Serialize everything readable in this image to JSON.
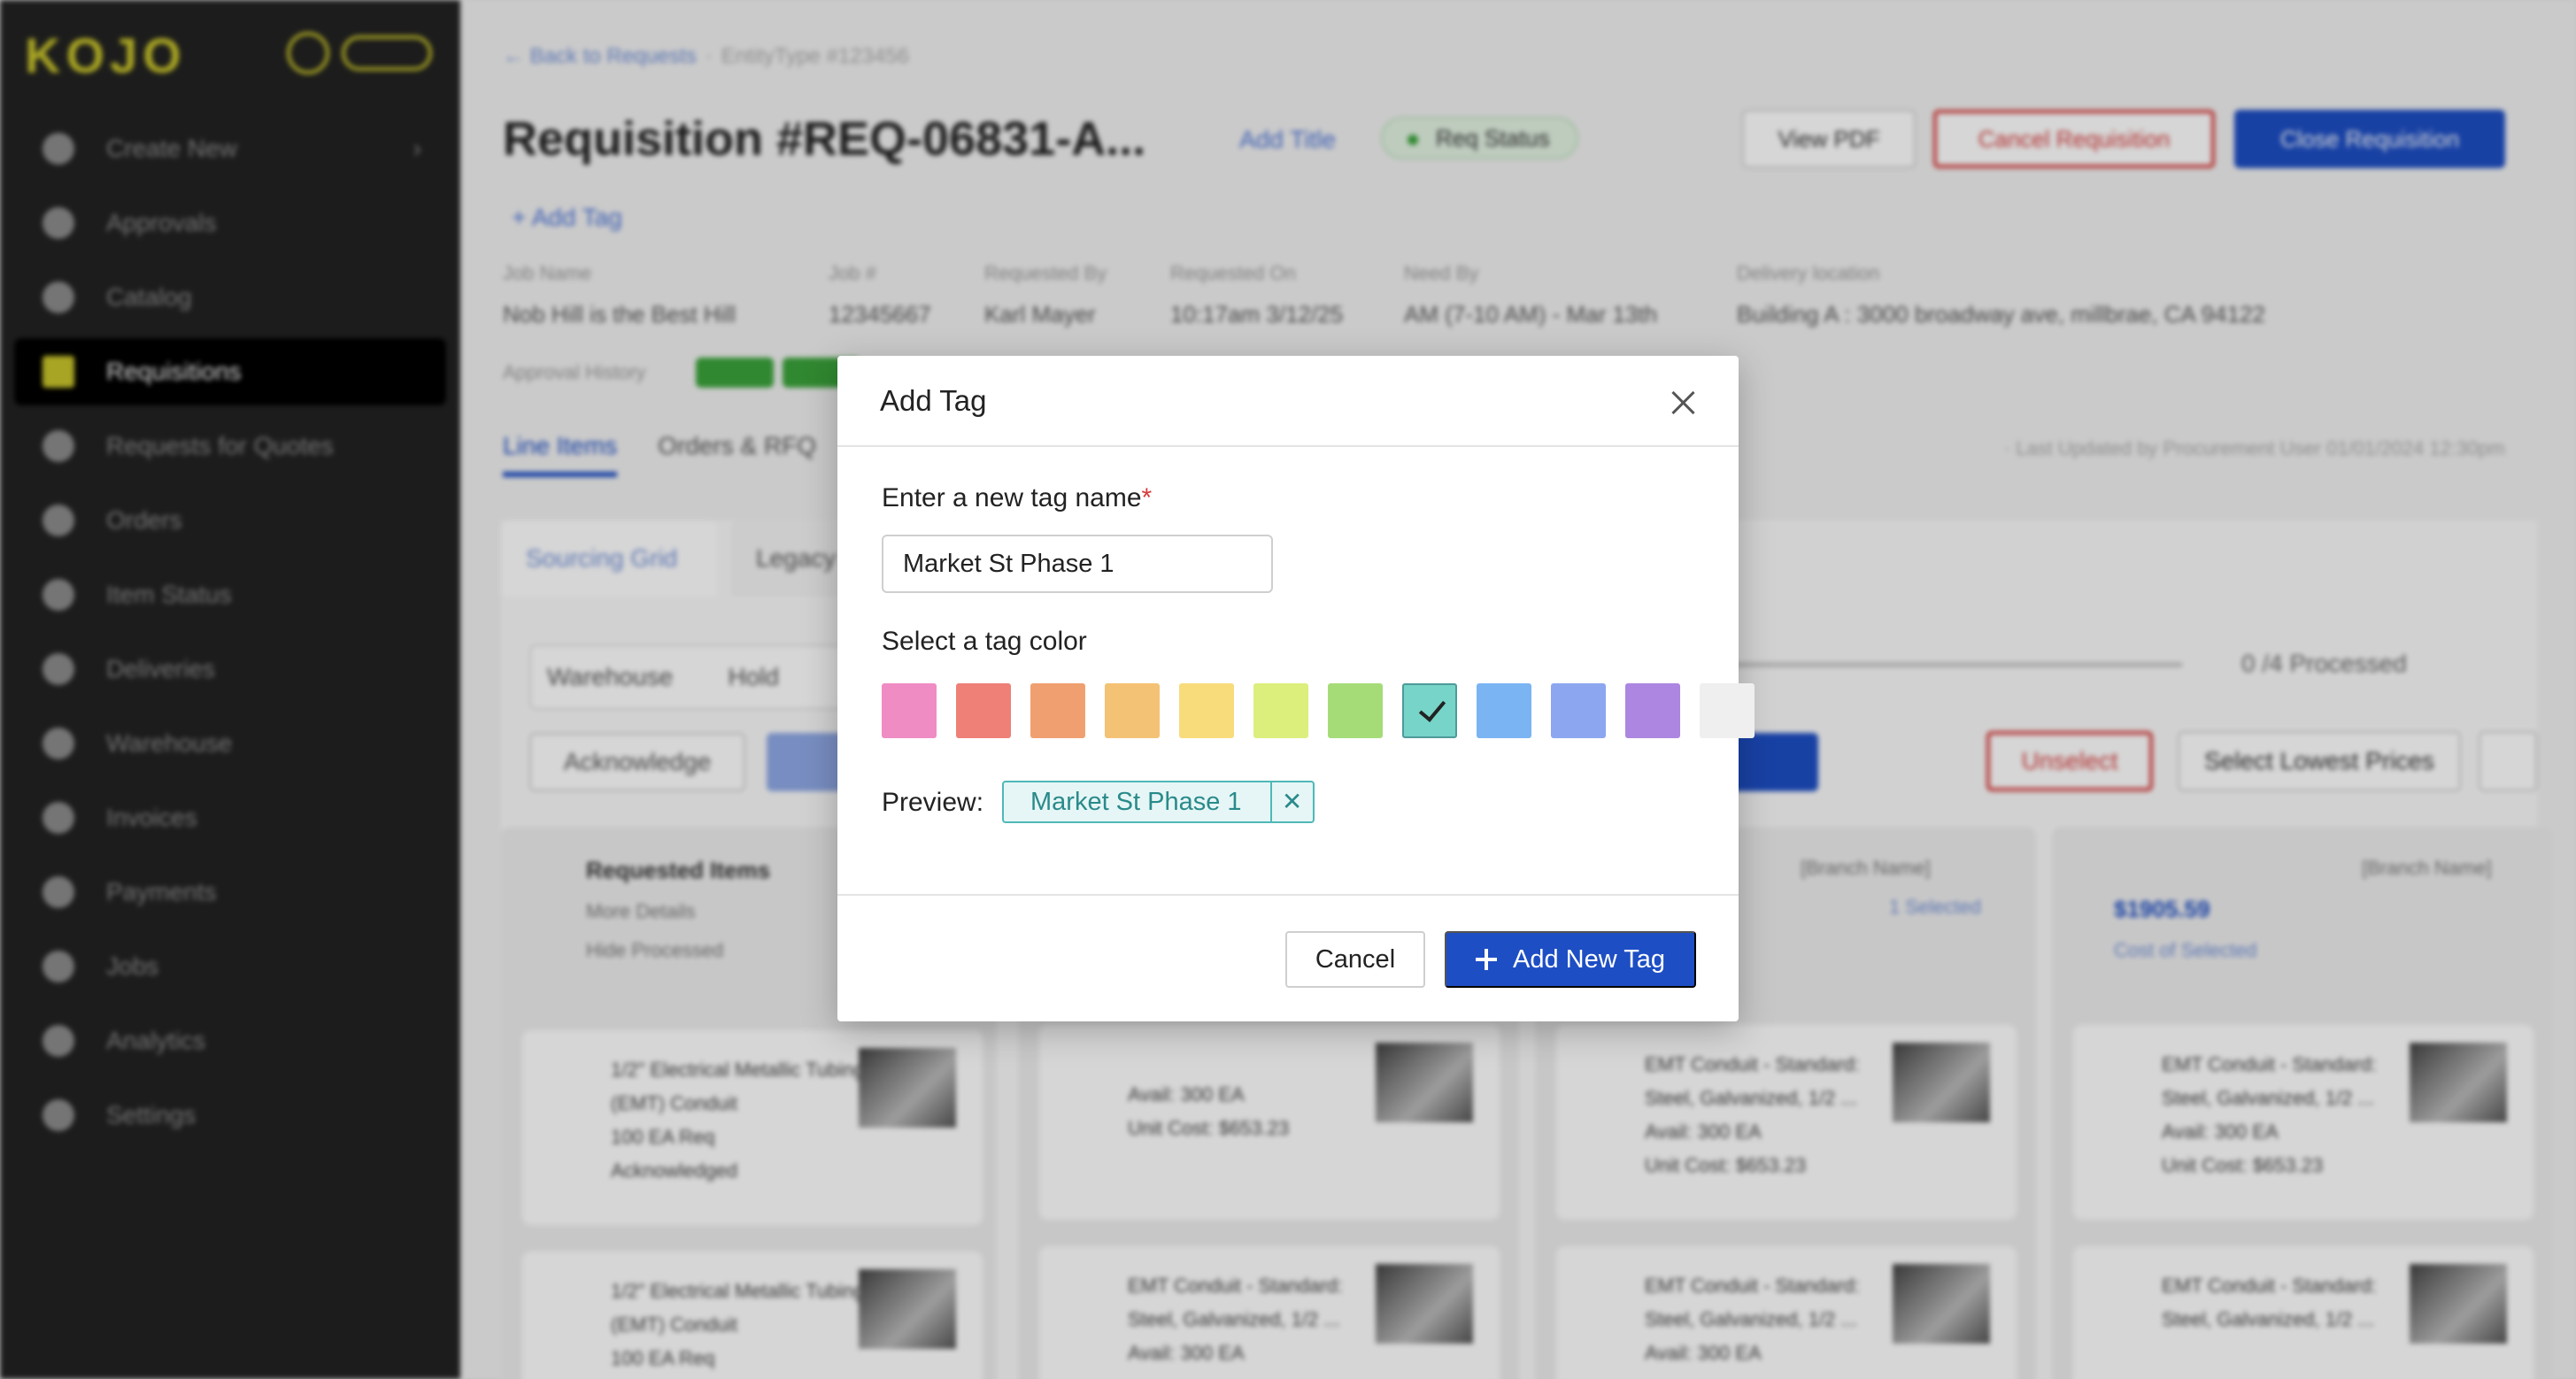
{
  "sidebar": {
    "logo": "KOJO",
    "items": [
      {
        "label": "Create New",
        "icon": "plus-circle-icon"
      },
      {
        "label": "Approvals",
        "icon": "thumbs-up-icon"
      },
      {
        "label": "Catalog",
        "icon": "search-icon"
      },
      {
        "label": "Requisitions",
        "icon": "download-icon"
      },
      {
        "label": "Requests for Quotes",
        "icon": "dollar-circle-icon"
      },
      {
        "label": "Orders",
        "icon": "document-icon"
      },
      {
        "label": "Item Status",
        "icon": "clipboard-icon"
      },
      {
        "label": "Deliveries",
        "icon": "truck-icon"
      },
      {
        "label": "Warehouse",
        "icon": "home-icon"
      },
      {
        "label": "Invoices",
        "icon": "invoice-icon"
      },
      {
        "label": "Payments",
        "icon": "dollar-circle-icon"
      },
      {
        "label": "Jobs",
        "icon": "location-pin-icon"
      },
      {
        "label": "Analytics",
        "icon": "bar-chart-icon"
      },
      {
        "label": "Settings",
        "icon": "gear-icon"
      }
    ],
    "active_index": 3,
    "chevron": "›"
  },
  "header": {
    "back_link": "← Back to Requests",
    "separator": "·",
    "entity": "EntityType #123456",
    "title": "Requisition #REQ-06831-A...",
    "add_title": "Add Title",
    "status": "Req Status",
    "view_pdf": "View PDF",
    "cancel_requisition": "Cancel Requisition",
    "close_requisition": "Close Requisition",
    "add_tag": "+ Add Tag"
  },
  "meta": [
    {
      "label": "Job Name",
      "value": "Nob Hill is the Best Hill"
    },
    {
      "label": "Job #",
      "value": "12345667"
    },
    {
      "label": "Requested By",
      "value": "Karl Mayer"
    },
    {
      "label": "Requested On",
      "value": "10:17am 3/12/25"
    },
    {
      "label": "Need By",
      "value": "AM (7-10 AM) - Mar 13th"
    },
    {
      "label": "Delivery location",
      "value": "Building A : 3000 broadway ave, millbrae, CA 94122"
    }
  ],
  "approval_history": "Approval History",
  "tabs": {
    "line_items": "Line Items",
    "orders": "Orders & RFQ"
  },
  "last_updated": "· Last Updated by Procurement User 01/01/2024 12:30pm",
  "grid": {
    "sourcing_tab": "Sourcing Grid",
    "legacy_tab": "Legacy",
    "warehouse": "Warehouse",
    "hold": "Hold",
    "processed": "0 /4 Processed",
    "acknowledge": "Acknowledge",
    "unselect": "Unselect",
    "select_lowest": "Select Lowest Prices",
    "requested_items": "Requested Items",
    "more_details": "More Details",
    "hide_processed": "Hide Processed",
    "branch": "[Branch Name]",
    "amount": "$1905.59",
    "cost_selected": "Cost of Selected",
    "selected": "1 Selected",
    "item1": "1/2\" Electrical Metallic Tubing (EMT) Conduit",
    "item_qty": "100 EA Req",
    "acknowledged": "Acknowledged",
    "emt": "EMT Conduit - Standard: Steel, Galvanized, 1/2 ...",
    "avail": "Avail: 300 EA",
    "unit_cost": "Unit Cost: $653.23"
  },
  "modal": {
    "title": "Add Tag",
    "name_label": "Enter a new tag name",
    "required_mark": "*",
    "name_value": "Market St Phase 1",
    "color_label": "Select a tag color",
    "colors": [
      "#f08cc4",
      "#ee8078",
      "#f0a070",
      "#f4c274",
      "#f8dc7c",
      "#dcee7c",
      "#a6dc78",
      "#76d4c8",
      "#7ab4f2",
      "#8ca6f0",
      "#ac86e0",
      "#efefef"
    ],
    "selected_color_index": 7,
    "preview_label": "Preview:",
    "preview_tag": "Market St Phase 1",
    "remove_glyph": "✕",
    "cancel": "Cancel",
    "add_new_tag": "Add New Tag"
  }
}
